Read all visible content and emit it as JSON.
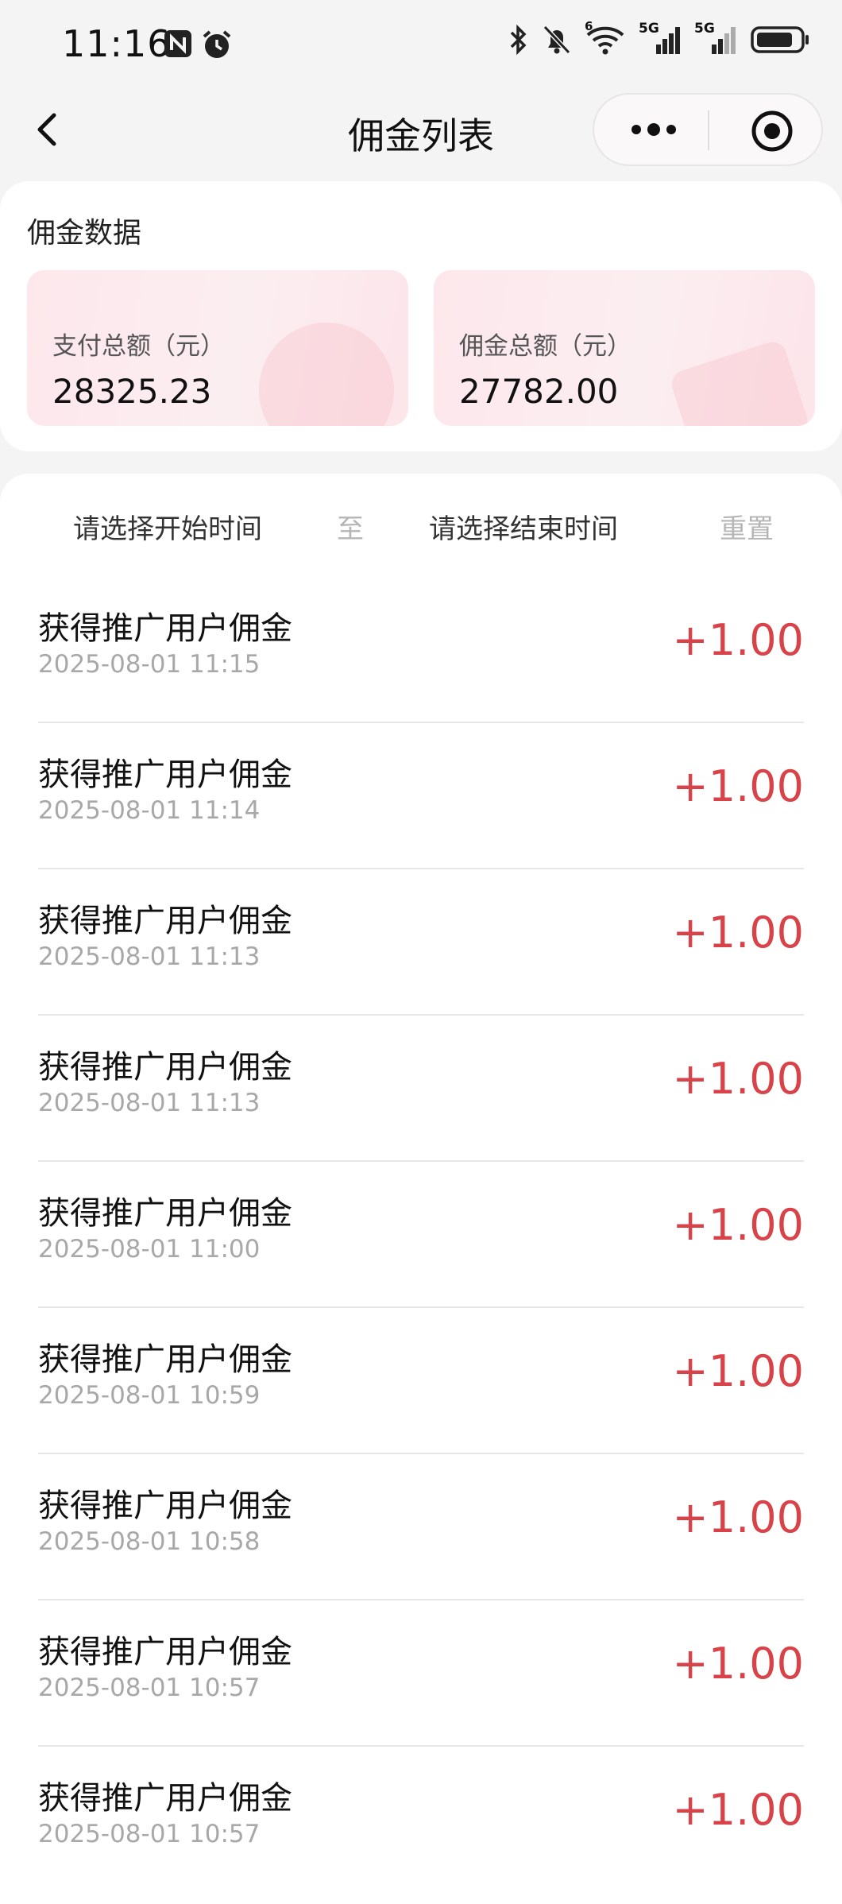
{
  "status_bar": {
    "time": "11:16",
    "left_icons": [
      "nfc-icon",
      "alarm-icon"
    ],
    "right_icons": [
      "bluetooth-icon",
      "mute-bell-icon",
      "wifi-icon",
      "signal-5g-icon",
      "signal-5g-icon",
      "battery-icon"
    ],
    "wifi_badge": "6",
    "network_label": "5G"
  },
  "nav": {
    "title": "佣金列表",
    "back_icon": "chevron-left-icon",
    "more_icon": "more-dots-icon",
    "close_icon": "target-circle-icon"
  },
  "summary": {
    "title": "佣金数据",
    "pay_total_label": "支付总额（元）",
    "pay_total_value": "28325.23",
    "commission_total_label": "佣金总额（元）",
    "commission_total_value": "27782.00"
  },
  "filter": {
    "start_placeholder": "请选择开始时间",
    "to_label": "至",
    "end_placeholder": "请选择结束时间",
    "reset_label": "重置"
  },
  "records": [
    {
      "title": "获得推广用户佣金",
      "time": "2025-08-01 11:15",
      "amount": "+1.00"
    },
    {
      "title": "获得推广用户佣金",
      "time": "2025-08-01 11:14",
      "amount": "+1.00"
    },
    {
      "title": "获得推广用户佣金",
      "time": "2025-08-01 11:13",
      "amount": "+1.00"
    },
    {
      "title": "获得推广用户佣金",
      "time": "2025-08-01 11:13",
      "amount": "+1.00"
    },
    {
      "title": "获得推广用户佣金",
      "time": "2025-08-01 11:00",
      "amount": "+1.00"
    },
    {
      "title": "获得推广用户佣金",
      "time": "2025-08-01 10:59",
      "amount": "+1.00"
    },
    {
      "title": "获得推广用户佣金",
      "time": "2025-08-01 10:58",
      "amount": "+1.00"
    },
    {
      "title": "获得推广用户佣金",
      "time": "2025-08-01 10:57",
      "amount": "+1.00"
    },
    {
      "title": "获得推广用户佣金",
      "time": "2025-08-01 10:57",
      "amount": "+1.00"
    }
  ],
  "colors": {
    "amount": "#d8434a",
    "muted": "#a8a8a8",
    "stat_bg": "#fde7ec"
  }
}
